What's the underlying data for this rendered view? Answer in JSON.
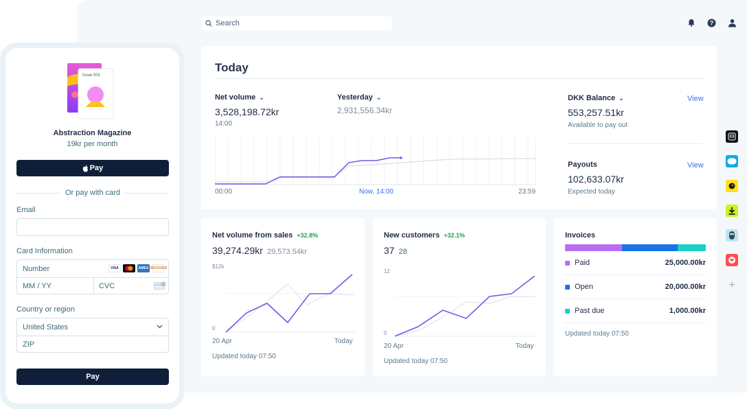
{
  "search": {
    "placeholder": "Search"
  },
  "today": {
    "title": "Today",
    "net_volume": {
      "label": "Net volume",
      "value": "3,528,198.72kr",
      "time": "14:00"
    },
    "yesterday": {
      "label": "Yesterday",
      "value": "2,931,556.34kr"
    },
    "axis": {
      "start": "00:00",
      "now": "Now, 14:00",
      "end": "23:59"
    },
    "balance": {
      "label": "DKK Balance",
      "value": "553,257.51kr",
      "sub": "Available to pay out",
      "link": "View"
    },
    "payouts": {
      "label": "Payouts",
      "value": "102,633.07kr",
      "sub": "Expected today",
      "link": "View"
    }
  },
  "sales": {
    "title": "Net volume from sales",
    "pct": "+32.8%",
    "value": "39,274.29kr",
    "compare": "29,573.54kr",
    "ytop": "$12k",
    "ybottom": "0",
    "xstart": "20 Apr",
    "xend": "Today",
    "updated": "Updated today 07:50"
  },
  "customers": {
    "title": "New customers",
    "pct": "+32.1%",
    "value": "37",
    "compare": "28",
    "ytop": "12",
    "ybottom": "0",
    "xstart": "20 Apr",
    "xend": "Today",
    "updated": "Updated today 07:50"
  },
  "invoices": {
    "title": "Invoices",
    "bar": [
      {
        "color": "#b86ef0",
        "fraction": 0.405
      },
      {
        "color": "#1a73e8",
        "fraction": 0.395
      },
      {
        "color": "#1ccfc9",
        "fraction": 0.2
      }
    ],
    "rows": [
      {
        "label": "Paid",
        "amount": "25,000.00kr",
        "color": "#b86ef0"
      },
      {
        "label": "Open",
        "amount": "20,000.00kr",
        "color": "#1a73e8"
      },
      {
        "label": "Past due",
        "amount": "1,000.00kr",
        "color": "#1ccfc9"
      }
    ],
    "updated": "Updated today 07:50"
  },
  "checkout": {
    "product_cover_text": "Issue 001",
    "product_name": "Abstraction Magazine",
    "price": "19kr per month",
    "apple_pay": "Pay",
    "or_pay": "Or pay with card",
    "email_label": "Email",
    "card_label": "Card Information",
    "number_placeholder": "Number",
    "expiry_placeholder": "MM / YY",
    "cvc_placeholder": "CVC",
    "country_label": "Country or region",
    "country_value": "United States",
    "zip_placeholder": "ZIP",
    "pay_button": "Pay",
    "brands": [
      "VISA",
      "mastercard",
      "AMEX",
      "DISCOVER"
    ]
  },
  "right_apps": [
    "intercom",
    "chat",
    "mailchimp",
    "download",
    "owl",
    "heart",
    "add"
  ]
}
